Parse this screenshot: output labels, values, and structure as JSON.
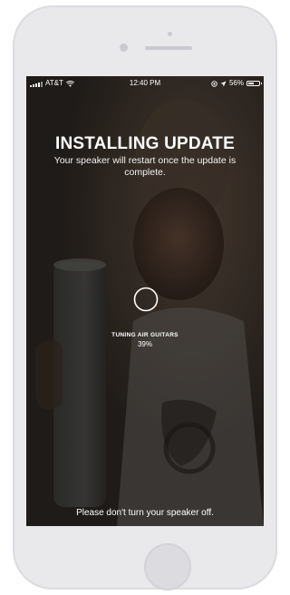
{
  "status_bar": {
    "carrier": "AT&T",
    "time": "12:40 PM",
    "battery_text": "56%",
    "battery_level": 0.56,
    "icons": [
      "signal-icon",
      "wifi-icon",
      "location-icon",
      "battery-icon"
    ]
  },
  "update": {
    "title": "INSTALLING UPDATE",
    "subtitle": "Your speaker will restart once the update is complete.",
    "progress_label": "TUNING AIR GUITARS",
    "progress_text": "39%",
    "progress": 0.39,
    "footer_note": "Please don't turn your speaker off."
  },
  "colors": {
    "device_frame": "#e9e9ec",
    "overlay": "#2a2724",
    "text": "#ffffff"
  }
}
